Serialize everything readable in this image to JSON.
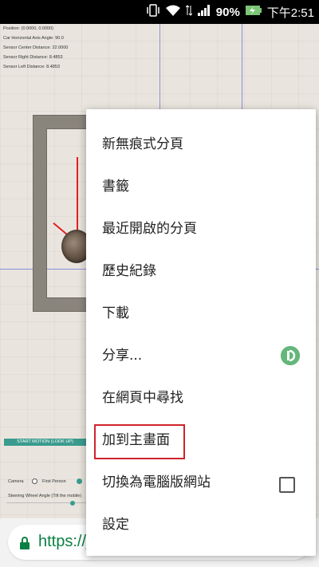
{
  "status_bar": {
    "battery_percent": "90%",
    "time": "下午2:51",
    "icons": [
      "vibrate-icon",
      "wifi-icon",
      "data-transfer-icon",
      "signal-icon",
      "battery-charging-icon"
    ]
  },
  "simulation": {
    "info_lines": [
      "Position: (0.0000, 0.0000)",
      "Car Horizontal Axis Angle: 90.0",
      "Sensor Center Distance: 22.0000",
      "Sensor Right Distance: 8.4853",
      "Sensor Left Distance: 8.4853"
    ],
    "controls": {
      "start_button": "START MOTION (LOOK UP)",
      "camera_label": "Camera",
      "first_person_label": "First Person",
      "steering_label": "Steering Wheel Angle (Tilt the mobile)"
    }
  },
  "address_bar": {
    "url_text": "https://j"
  },
  "menu": {
    "items": [
      {
        "label": "新無痕式分頁"
      },
      {
        "label": "書籤"
      },
      {
        "label": "最近開啟的分頁"
      },
      {
        "label": "歷史紀錄"
      },
      {
        "label": "下載"
      },
      {
        "label": "分享..."
      },
      {
        "label": "在網頁中尋找"
      },
      {
        "label": "加到主畫面"
      },
      {
        "label": "切換為電腦版網站"
      },
      {
        "label": "設定"
      }
    ],
    "highlighted_item": "加到主畫面",
    "highlight_color": "#d0232a",
    "share_icon_color": "#63b77a"
  }
}
